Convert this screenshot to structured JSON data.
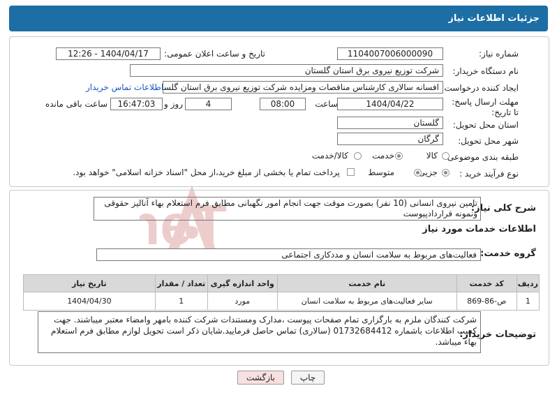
{
  "header": {
    "title": "جزئیات اطلاعات نیاز"
  },
  "form": {
    "need_number": {
      "label": "شماره نیاز:",
      "value": "1104007006000090"
    },
    "announce_datetime": {
      "label": "تاریخ و ساعت اعلان عمومی:",
      "value": "1404/04/17 - 12:26"
    },
    "buyer_org": {
      "label": "نام دستگاه خریدار:",
      "value": "شرکت توزیع نیروی برق استان گلستان"
    },
    "requester": {
      "label": "ایجاد کننده درخواست:",
      "value": "افسانه سالاری کارشناس مناقصات ومزایده شرکت توزیع نیروی برق استان گلستان",
      "contact_link": "اطلاعات تماس خریدار"
    },
    "deadline": {
      "label": "مهلت ارسال پاسخ: تا تاریخ:",
      "date": "1404/04/22",
      "time_label": "ساعت",
      "time": "08:00",
      "days": "4",
      "days_label": "روز و",
      "remaining": "16:47:03",
      "remaining_label": "ساعت باقی مانده"
    },
    "delivery_province": {
      "label": "استان محل تحویل:",
      "value": "گلستان"
    },
    "delivery_city": {
      "label": "شهر محل تحویل:",
      "value": "گرگان"
    },
    "category": {
      "label": "طبقه بندی موضوعی:",
      "options": [
        "کالا",
        "خدمت",
        "کالا/خدمت"
      ],
      "selected": "خدمت"
    },
    "process": {
      "label": "نوع فرآیند خرید :",
      "options": [
        "جزیی",
        "متوسط"
      ],
      "selected": "متوسط",
      "payment_note": "پرداخت تمام یا بخشی از مبلغ خرید،از محل \"اسناد خزانه اسلامی\" خواهد بود."
    }
  },
  "summary": {
    "label": "شرح کلی نیاز:",
    "text": "تامین نیروی انسانی (10 نفر) بصورت موقت جهت انجام امور نگهبانی مطابق فرم استعلام بهاء آنالیز حقوقی ونمونه قراردادپیوست"
  },
  "services": {
    "section_title": "اطلاعات خدمات مورد نیاز",
    "group_label": "گروه خدمت:",
    "group_value": "فعالیت‌های مربوط به سلامت انسان و مددکاری اجتماعی",
    "columns": [
      "ردیف",
      "کد خدمت",
      "نام خدمت",
      "واحد اندازه گیری",
      "تعداد / مقدار",
      "تاریخ نیاز"
    ],
    "rows": [
      [
        "1",
        "ص-86-869",
        "سایر فعالیت‌های مربوط به سلامت انسان",
        "مورد",
        "1",
        "1404/04/30"
      ]
    ]
  },
  "buyer_notes": {
    "label": "توضیحات خریدار:",
    "text": "شرکت کنندگان ملزم به بارگزاری تمام صفحات پیوست ،مدارک ومستندات شرکت کننده بامهر وامضاء معتبر میباشند. جهت کسب اطلاعات باشماره 01732684412 (سالاری) تماس حاصل فرمایید.شایان ذکر است تحویل لوازم مطابق فرم استعلام بهاء میباشد."
  },
  "buttons": {
    "print": "چاپ",
    "back": "بازگشت"
  },
  "watermark": {
    "text": "AriaTender.neT"
  },
  "colors": {
    "header": "#1c6ea4",
    "link": "#1a55c0",
    "back_button": "#f9e0e0",
    "watermark": "#e8b5b5"
  }
}
